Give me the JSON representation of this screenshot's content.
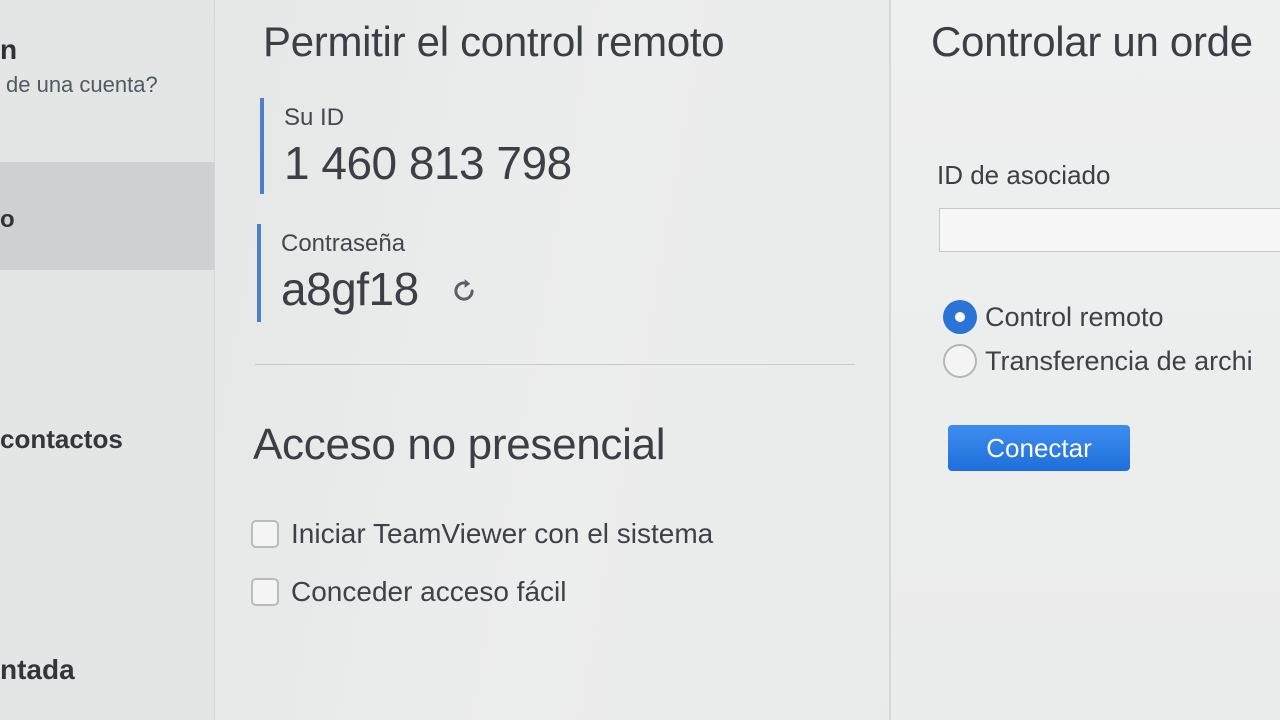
{
  "sidebar": {
    "title_fragment": "n",
    "account_link": "de una cuenta?",
    "selected_item": "o",
    "contacts_item": "contactos",
    "bottom_item": "ntada"
  },
  "allow_remote": {
    "title": "Permitir el control remoto",
    "id_label": "Su ID",
    "id_value": "1 460 813 798",
    "password_label": "Contraseña",
    "password_value": "a8gf18",
    "refresh_icon": "refresh-icon"
  },
  "unattended": {
    "title": "Acceso no presencial",
    "options": [
      {
        "label": "Iniciar TeamViewer con el sistema",
        "checked": false
      },
      {
        "label": "Conceder acceso fácil",
        "checked": false
      }
    ]
  },
  "control_remote": {
    "title": "Controlar un orde",
    "partner_label": "ID de asociado",
    "partner_value": "",
    "modes": [
      {
        "label": "Control remoto",
        "selected": true
      },
      {
        "label": "Transferencia de archi",
        "selected": false
      }
    ],
    "connect_label": "Conectar"
  },
  "colors": {
    "accent": "#2b73d6",
    "id_bar": "#4a80c8"
  }
}
